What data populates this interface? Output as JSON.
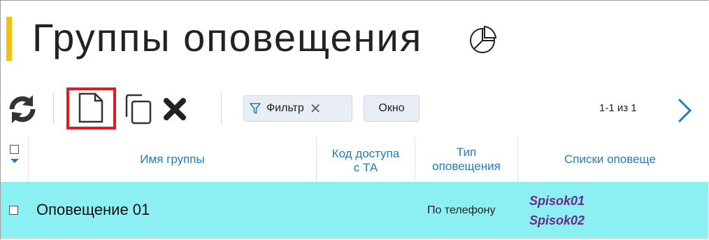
{
  "page": {
    "title": "Группы оповещения"
  },
  "toolbar": {
    "filter_label": "Фильтр",
    "filter_clear": "✕",
    "window_label": "Окно",
    "pager_text": "1-1 из 1"
  },
  "table": {
    "columns": {
      "name": "Имя группы",
      "access_code": "Код доступа\nс ТА",
      "notify_type": "Тип\nоповещения",
      "lists": "Списки оповеще"
    },
    "rows": [
      {
        "name": "Оповещение 01",
        "notify_type": "По телефону",
        "lists": [
          "Spisok01",
          "Spisok02"
        ]
      }
    ]
  },
  "colors": {
    "accent": "#f5c100",
    "header_text": "#2a7ab8",
    "selected_row": "#8cf0f2",
    "highlight_box": "#e21b22",
    "list_link": "#6a2a8a"
  },
  "icons": {
    "chart": "pie-chart-icon",
    "refresh": "refresh-icon",
    "new": "new-document-icon",
    "copy": "copy-icon",
    "delete": "delete-icon",
    "filter": "filter-funnel-icon",
    "next": "chevron-right-icon"
  }
}
